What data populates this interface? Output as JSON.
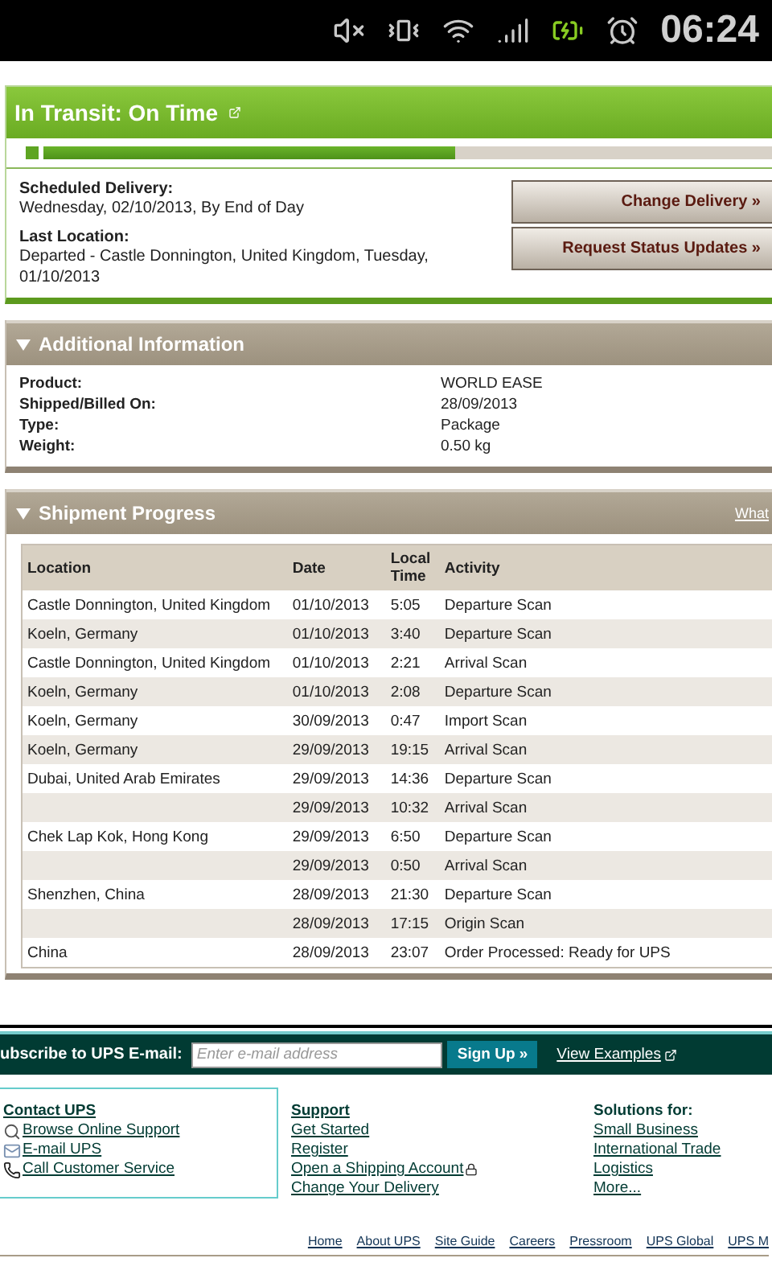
{
  "status_bar": {
    "time": "06:24"
  },
  "tracking": {
    "status": "In Transit: On Time",
    "progress": {
      "level": 0.53
    },
    "details": [
      {
        "label": "Scheduled Delivery:",
        "value": "Wednesday, 02/10/2013, By End of Day"
      },
      {
        "label": "Last Location:",
        "value": "Departed - Castle Donnington, United Kingdom, Tuesday, 01/10/2013"
      }
    ],
    "buttons": [
      "Change Delivery »",
      "Request Status Updates »"
    ]
  },
  "additional_information": {
    "title": "Additional Information",
    "expanded": true,
    "rows": [
      {
        "label": "Product:",
        "value": "WORLD EASE"
      },
      {
        "label": "Shipped/Billed On:",
        "value": "28/09/2013"
      },
      {
        "label": "Type:",
        "value": "Package"
      },
      {
        "label": "Weight:",
        "value": "0.50 kg"
      }
    ]
  },
  "shipment_progress": {
    "title": "Shipment Progress",
    "expanded": true,
    "link": "What",
    "columns": [
      "Location",
      "Date",
      "Local Time",
      "Activity"
    ],
    "rows": [
      [
        "Castle Donnington, United Kingdom",
        "01/10/2013",
        "5:05",
        "Departure Scan"
      ],
      [
        "Koeln, Germany",
        "01/10/2013",
        "3:40",
        "Departure Scan"
      ],
      [
        "Castle Donnington, United Kingdom",
        "01/10/2013",
        "2:21",
        "Arrival Scan"
      ],
      [
        "Koeln, Germany",
        "01/10/2013",
        "2:08",
        "Departure Scan"
      ],
      [
        "Koeln, Germany",
        "30/09/2013",
        "0:47",
        "Import Scan"
      ],
      [
        "Koeln, Germany",
        "29/09/2013",
        "19:15",
        "Arrival Scan"
      ],
      [
        "Dubai, United Arab Emirates",
        "29/09/2013",
        "14:36",
        "Departure Scan"
      ],
      [
        "",
        "29/09/2013",
        "10:32",
        "Arrival Scan"
      ],
      [
        "Chek Lap Kok, Hong Kong",
        "29/09/2013",
        "6:50",
        "Departure Scan"
      ],
      [
        "",
        "29/09/2013",
        "0:50",
        "Arrival Scan"
      ],
      [
        "Shenzhen, China",
        "28/09/2013",
        "21:30",
        "Departure Scan"
      ],
      [
        "",
        "28/09/2013",
        "17:15",
        "Origin Scan"
      ],
      [
        "China",
        "28/09/2013",
        "23:07",
        "Order Processed: Ready for UPS"
      ]
    ]
  },
  "subscribe": {
    "label": "ubscribe to UPS E-mail:",
    "placeholder": "Enter e-mail address",
    "button": "Sign Up »",
    "link": "View Examples"
  },
  "footer": {
    "columns": [
      {
        "title": "Contact UPS",
        "boxed": true,
        "links": [
          {
            "text": "Browse Online Support",
            "kind": "search"
          },
          {
            "text": "E-mail UPS",
            "kind": "mail"
          },
          {
            "text": "Call Customer Service",
            "kind": "phone"
          }
        ]
      },
      {
        "title": "Support",
        "boxed": false,
        "links": [
          {
            "text": "Get Started",
            "kind": "plain"
          },
          {
            "text": "Register",
            "kind": "plain"
          },
          {
            "text": "Open a Shipping Account",
            "kind": "secure"
          },
          {
            "text": "Change Your Delivery",
            "kind": "plain"
          }
        ]
      },
      {
        "title": "Solutions for:",
        "boxed": false,
        "links": [
          {
            "text": "Small Business",
            "kind": "plain"
          },
          {
            "text": "International Trade",
            "kind": "plain"
          },
          {
            "text": "Logistics",
            "kind": "plain"
          },
          {
            "text": "More...",
            "kind": "plain"
          }
        ]
      }
    ],
    "bottom_links": [
      "Home",
      "About UPS",
      "Site Guide",
      "Careers",
      "Pressroom",
      "UPS Global",
      "UPS M"
    ]
  }
}
